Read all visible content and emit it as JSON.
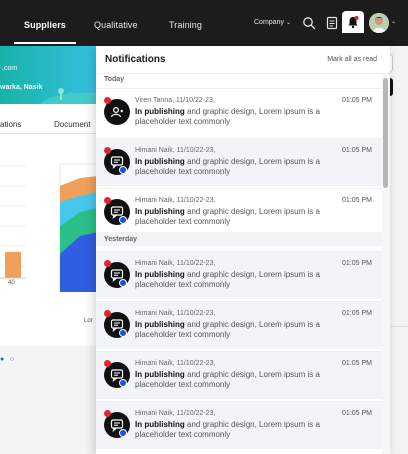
{
  "nav": {
    "tabs": [
      {
        "label": "Suppliers"
      },
      {
        "label": "Qualitative"
      },
      {
        "label": "Training"
      }
    ],
    "company_label": "Company",
    "icons": [
      "search-icon",
      "document-icon",
      "bell-icon",
      "avatar",
      "chevron-down-icon"
    ]
  },
  "background": {
    "banner_line1": ".com",
    "banner_line2": "warka, Nasik",
    "tab_left": "ations",
    "tab_right": "Document",
    "bar_value": "40",
    "lor": "Lor"
  },
  "notifications": {
    "title": "Notifications",
    "mark_all": "Mark all as read",
    "sections": [
      {
        "label": "Today",
        "items": [
          {
            "meta": "Viren Tanna, 11/10/22-23,",
            "time": "01:05 PM",
            "bold": "In publishing",
            "text": " and graphic design, Lorem ipsum is a placeholder text commonly",
            "icon": "user-icon",
            "badge": false
          },
          {
            "meta": "Himani Naik, 11/10/22-23,",
            "time": "01:05 PM",
            "bold": "In publishing",
            "text": " and graphic design, Lorem ipsum is a placeholder text commonly",
            "icon": "chat-icon",
            "badge": true
          },
          {
            "meta": "Himani Naik, 11/10/22-23,",
            "time": "01:05 PM",
            "bold": "In publishing",
            "text": " and graphic design, Lorem ipsum is a placeholder text commonly",
            "icon": "chat-icon",
            "badge": true
          }
        ]
      },
      {
        "label": "Yesterday",
        "items": [
          {
            "meta": "Himani Naik, 11/10/22-23,",
            "time": "01:05 PM",
            "bold": "In publishing",
            "text": " and graphic design, Lorem ipsum is a placeholder text commonly",
            "icon": "chat-icon",
            "badge": true
          },
          {
            "meta": "Himani Naik, 11/10/22-23,",
            "time": "01:05 PM",
            "bold": "In publishing",
            "text": " and graphic design, Lorem ipsum is a placeholder text commonly",
            "icon": "chat-icon",
            "badge": true
          },
          {
            "meta": "Himani Naik, 11/10/22-23,",
            "time": "01:05 PM",
            "bold": "In publishing",
            "text": " and graphic design, Lorem ipsum is a placeholder text commonly",
            "icon": "chat-icon",
            "badge": true
          },
          {
            "meta": "Himani Naik, 11/10/22-23,",
            "time": "01:05 PM",
            "bold": "In publishing",
            "text": " and graphic design, Lorem ipsum is a placeholder text commonly",
            "icon": "chat-icon",
            "badge": true
          }
        ]
      }
    ]
  },
  "colors": {
    "nav_bg": "#1c1c1c",
    "unread_dot": "#e0262f",
    "badge": "#1d4ed8",
    "banner_start": "#18b3a8",
    "banner_end": "#35c0e0"
  }
}
